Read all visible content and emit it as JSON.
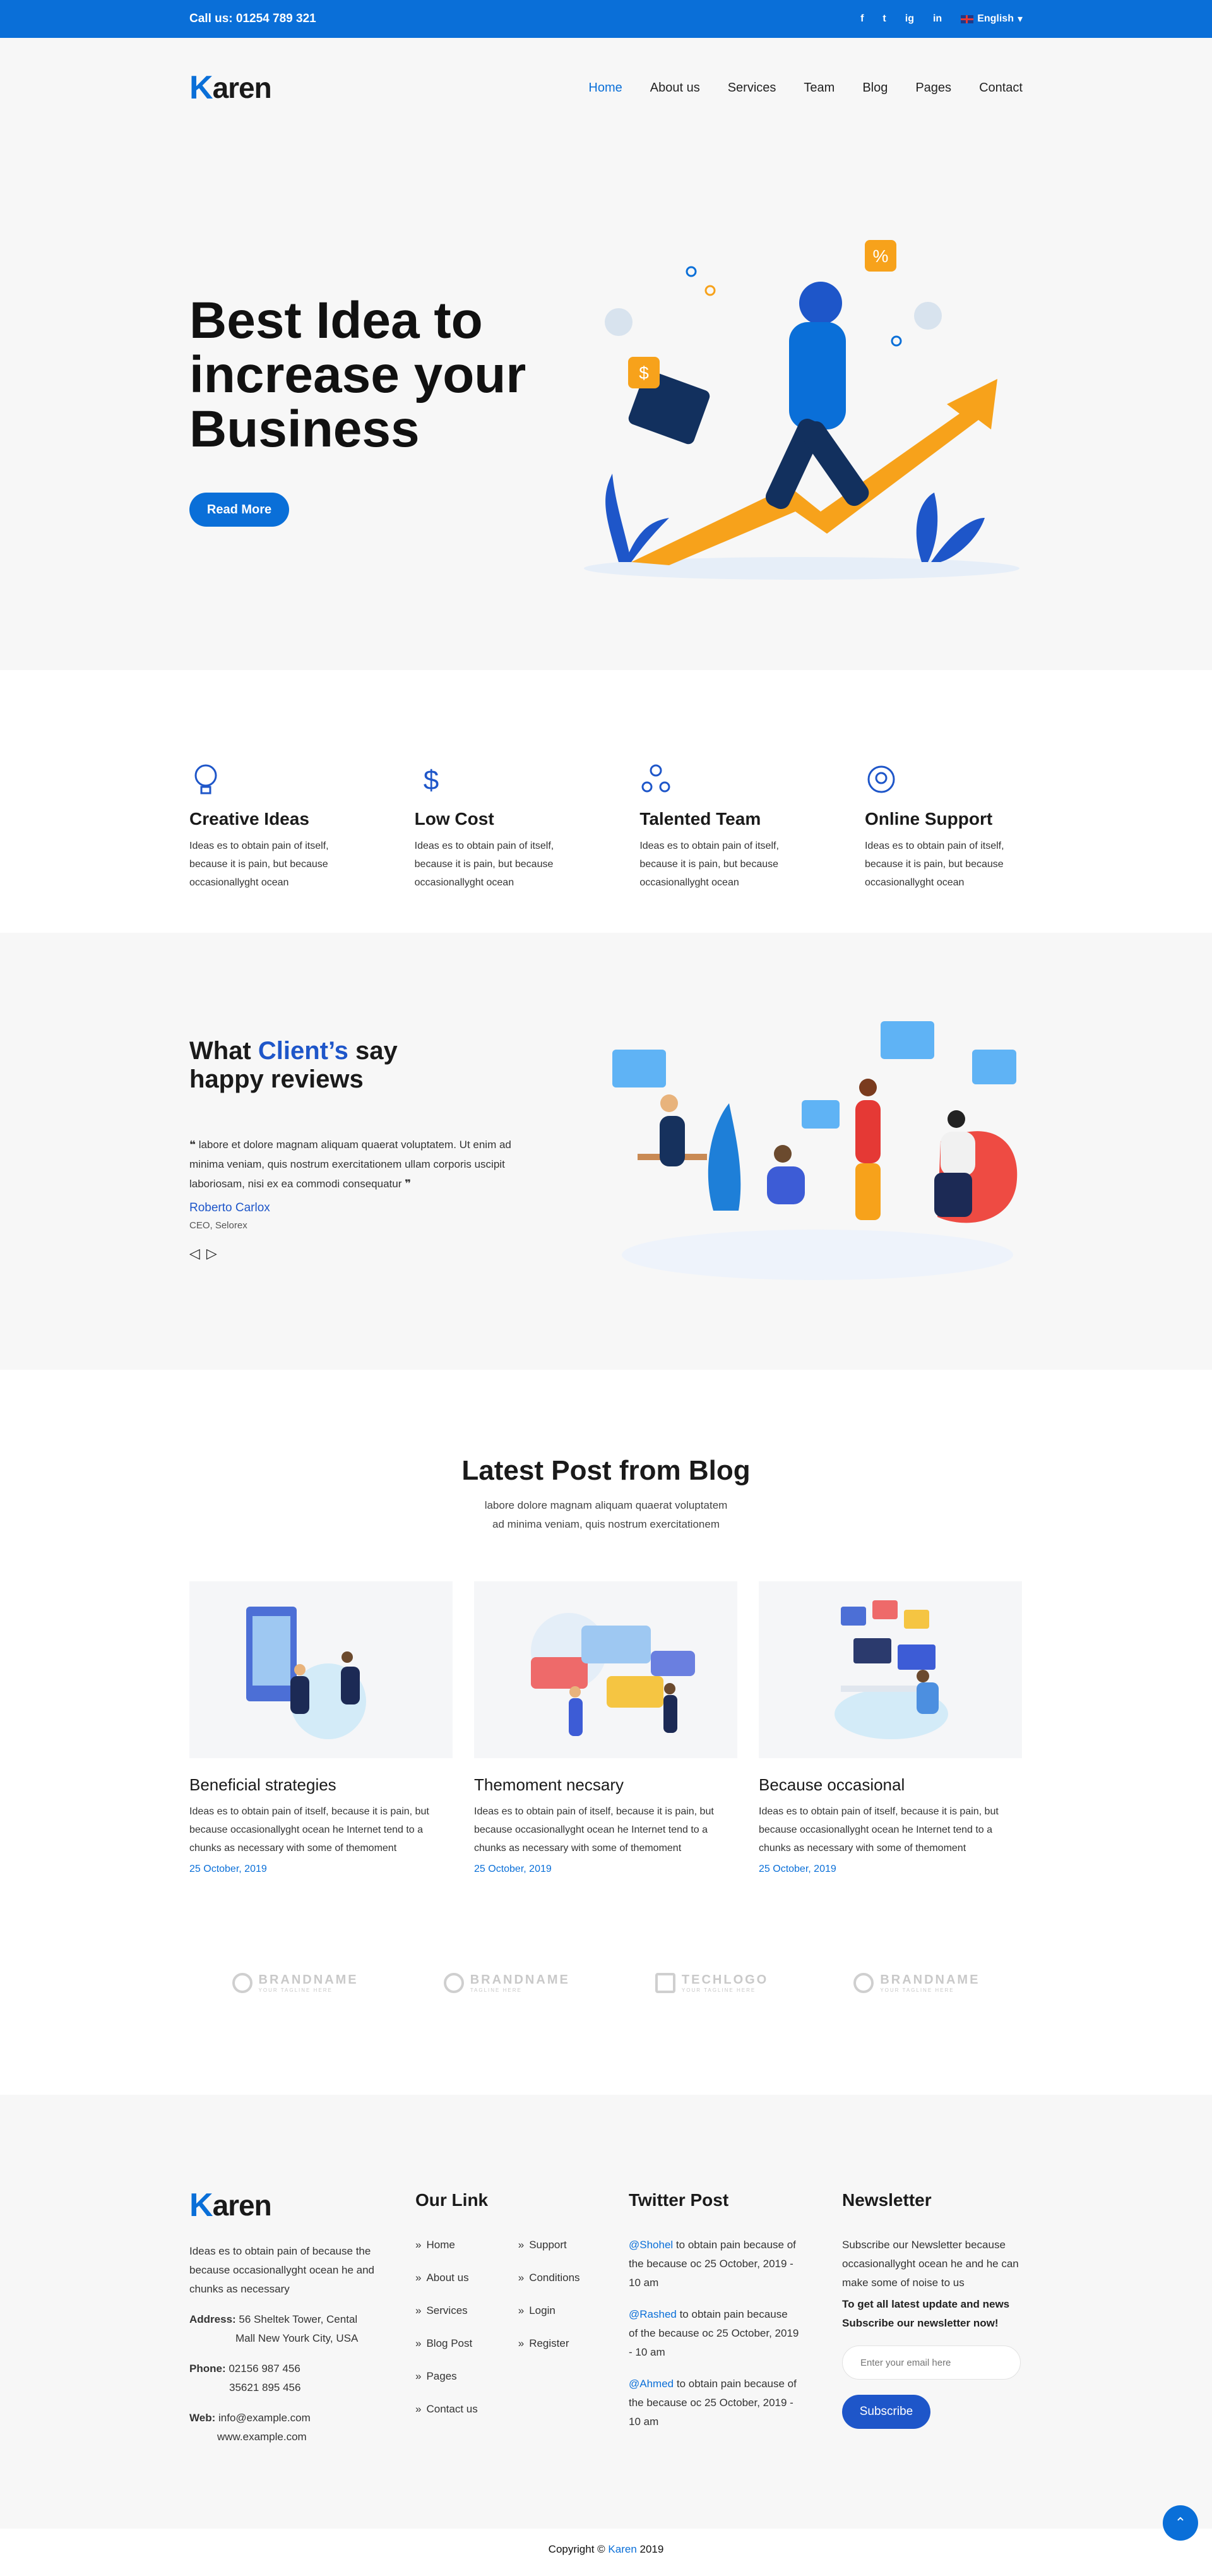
{
  "topbar": {
    "phone": "Call us: 01254 789 321",
    "social": [
      "f",
      "t",
      "ig",
      "in"
    ],
    "language": "English"
  },
  "brand": {
    "logo_first": "K",
    "logo_rest": "aren"
  },
  "nav": {
    "items": [
      "Home",
      "About us",
      "Services",
      "Team",
      "Blog",
      "Pages",
      "Contact"
    ],
    "active": "Home"
  },
  "hero": {
    "title": "Best Idea to increase your Business",
    "cta": "Read More"
  },
  "features": [
    {
      "icon": "lightbulb-icon",
      "title": "Creative Ideas",
      "text": "Ideas es to obtain pain of itself, because it is pain, but because occasionallyght ocean"
    },
    {
      "icon": "dollar-icon",
      "title": "Low Cost",
      "text": "Ideas es to obtain pain of itself, because it is pain, but because occasionallyght ocean"
    },
    {
      "icon": "team-icon",
      "title": "Talented Team",
      "text": "Ideas es to obtain pain of itself, because it is pain, but because occasionallyght ocean"
    },
    {
      "icon": "support-icon",
      "title": "Online Support",
      "text": "Ideas es to obtain pain of itself, because it is pain, but because occasionallyght ocean"
    }
  ],
  "reviews": {
    "title_pre": "What ",
    "title_highlight": "Client’s",
    "title_post": " say happy reviews",
    "quote": "labore et dolore magnam aliquam quaerat voluptatem. Ut enim ad minima veniam, quis nostrum exercitationem ullam corporis uscipit laboriosam, nisi ex ea commodi consequatur",
    "author": "Roberto Carlox",
    "role": "CEO, Selorex"
  },
  "blog": {
    "title": "Latest Post from Blog",
    "subtitle_1": "labore dolore magnam aliquam quaerat voluptatem",
    "subtitle_2": "ad minima veniam, quis nostrum exercitationem",
    "posts": [
      {
        "title": "Beneficial strategies",
        "text": "Ideas es to obtain pain of itself, because it is pain, but because occasionallyght ocean he Internet tend to a chunks as necessary with some of themoment",
        "date": "25 October, 2019"
      },
      {
        "title": "Themoment necsary",
        "text": "Ideas es to obtain pain of itself, because it is pain, but because occasionallyght ocean he Internet tend to a chunks as necessary with some of themoment",
        "date": "25 October, 2019"
      },
      {
        "title": "Because occasional",
        "text": "Ideas es to obtain pain of itself, because it is pain, but because occasionallyght ocean he Internet tend to a chunks as necessary with some of themoment",
        "date": "25 October, 2019"
      }
    ]
  },
  "brands": [
    {
      "name": "BRANDNAME",
      "tag": "YOUR TAGLINE HERE"
    },
    {
      "name": "BRANDNAME",
      "tag": "TAGLINE HERE"
    },
    {
      "name": "TECHLOGO",
      "tag": "YOUR TAGLINE HERE"
    },
    {
      "name": "BRANDNAME",
      "tag": "YOUR TAGLINE HERE"
    }
  ],
  "footer": {
    "about": "Ideas es to obtain pain of because the because occasionallyght ocean he and chunks as necessary",
    "address_label": "Address:",
    "address_1": "56 Sheltek Tower, Cental",
    "address_2": "Mall New Yourk City, USA",
    "phone_label": "Phone:",
    "phone_1": "02156 987 456",
    "phone_2": "35621 895 456",
    "web_label": "Web:",
    "web_1": "info@example.com",
    "web_2": "www.example.com",
    "links_title": "Our Link",
    "links_col1": [
      "Home",
      "About us",
      "Services",
      "Blog Post",
      "Pages",
      "Contact us"
    ],
    "links_col2": [
      "Support",
      "Conditions",
      "Login",
      "Register"
    ],
    "twitter_title": "Twitter Post",
    "tweets": [
      {
        "handle": "@Shohel",
        "text": " to obtain pain because of the because oc 25 October, 2019 - 10 am"
      },
      {
        "handle": "@Rashed",
        "text": " to obtain pain because of the because oc 25 October, 2019 - 10 am"
      },
      {
        "handle": "@Ahmed",
        "text": " to obtain pain because of the because oc 25 October, 2019 - 10 am"
      }
    ],
    "newsletter_title": "Newsletter",
    "newsletter_text": "Subscribe our Newsletter because occasionallyght ocean he and he can make some of noise to us",
    "newsletter_bold": "To get all latest update and news Subscribe our newsletter now!",
    "email_placeholder": "Enter your email here",
    "subscribe": "Subscribe"
  },
  "copyright": {
    "pre": "Copyright © ",
    "brand": "Karen",
    "year": " 2019"
  },
  "colors": {
    "primary": "#0a6fd8",
    "accent_blue": "#1e56c9",
    "orange": "#f7a21b",
    "background": "#f7f7f7"
  }
}
